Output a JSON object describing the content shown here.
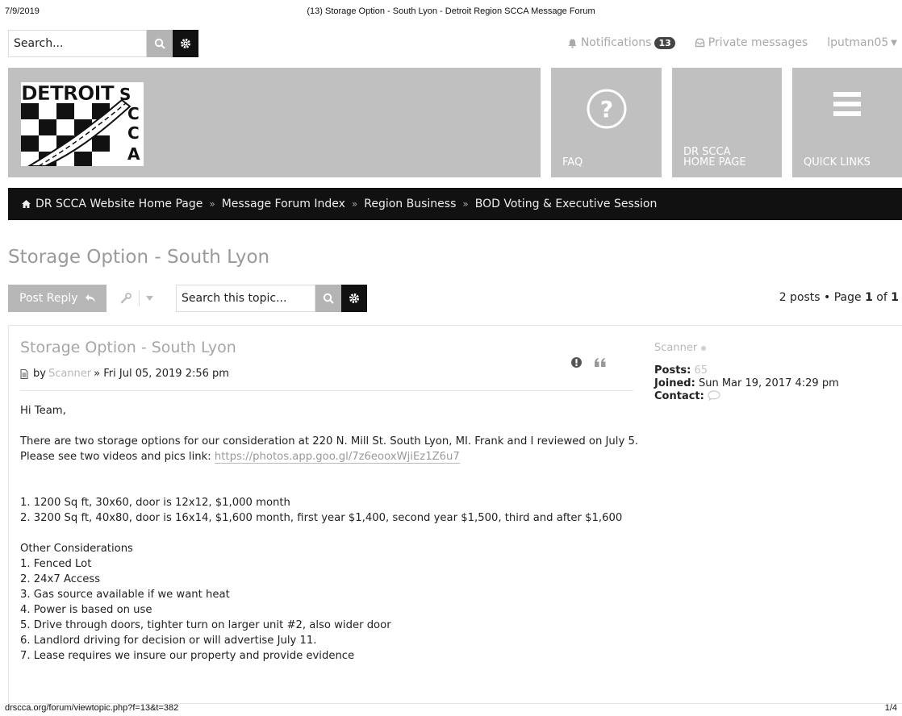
{
  "print": {
    "date": "7/9/2019",
    "title": "(13) Storage Option - South Lyon - Detroit Region SCCA Message Forum",
    "url": "drscca.org/forum/viewtopic.php?f=13&t=382",
    "page": "1/4"
  },
  "header": {
    "search_placeholder": "Search...",
    "notifications_label": "Notifications",
    "notifications_count": "13",
    "private_messages_label": "Private messages",
    "username": "lputman05",
    "logo_word": "DETROIT",
    "logo_letters": [
      "S",
      "C",
      "C",
      "A"
    ],
    "tiles": [
      {
        "label": "FAQ"
      },
      {
        "label": "DR SCCA\nHOME PAGE"
      },
      {
        "label": "QUICK LINKS"
      }
    ]
  },
  "breadcrumb": [
    "DR SCCA Website Home Page",
    "Message Forum Index",
    "Region Business",
    "BOD Voting & Executive Session"
  ],
  "breadcrumb_sep": "»",
  "topic": {
    "title": "Storage Option - South Lyon",
    "post_reply_label": "Post Reply",
    "search_placeholder": "Search this topic...",
    "pagination_prefix": "2 posts • Page ",
    "page_current": "1",
    "page_of": " of ",
    "page_total": "1"
  },
  "post": {
    "title": "Storage Option - South Lyon",
    "by_label": "by",
    "author": "Scanner",
    "date_sep": "»",
    "date": "Fri Jul 05, 2019 2:56 pm",
    "greeting": "Hi Team,",
    "intro_text": "There are two storage options for our consideration at 220 N. Mill St. South Lyon, MI. Frank and I reviewed on July 5. Please see two videos and pics link: ",
    "link": "https://photos.app.goo.gl/7z6eooxWjiEz1Z6u7",
    "options": [
      "1. 1200 Sq ft, 30x60, door is 12x12, $1,000 month",
      "2. 3200 Sq ft, 40x80, door is 16x14, $1,600 month, first year $1,400, second year $1,500, third and after $1,600"
    ],
    "considerations_heading": "Other Considerations",
    "considerations": [
      "1. Fenced Lot",
      "2. 24x7 Access",
      "3. Gas source available if we want heat",
      "4. Power is based on use",
      "5. Drive through doors, tighter turn on larger unit #2, also wider door",
      "6. Landlord driving for decision or will advertise July 11.",
      "7. Lease requires we insure our property and provide evidence"
    ]
  },
  "profile": {
    "name": "Scanner",
    "posts_label": "Posts:",
    "posts_value": "65",
    "joined_label": "Joined:",
    "joined_value": "Sun Mar 19, 2017 4:29 pm",
    "contact_label": "Contact:"
  }
}
